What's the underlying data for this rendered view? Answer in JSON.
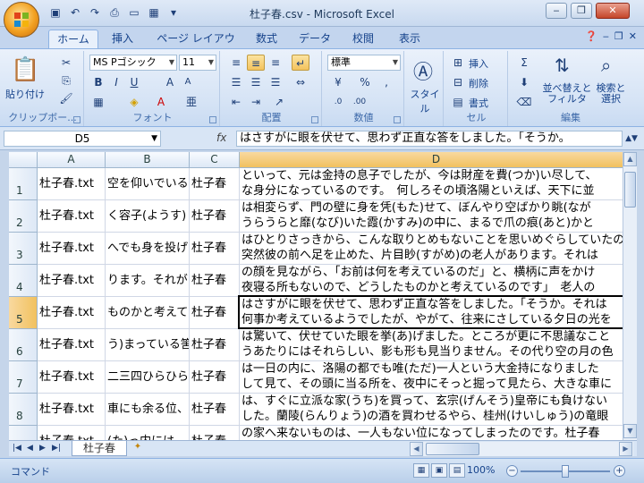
{
  "window": {
    "title": "杜子春.csv - Microsoft Excel",
    "controls": [
      "‒",
      "❐",
      "✕"
    ]
  },
  "tabs": [
    "ホーム",
    "挿入",
    "ページ レイアウト",
    "数式",
    "データ",
    "校閲",
    "表示"
  ],
  "ribbon": {
    "clipboard": {
      "paste_label": "貼り付け",
      "group_label": "クリップボー..."
    },
    "font": {
      "font_name": "MS Pゴシック",
      "font_size": "11",
      "bold": "B",
      "italic": "I",
      "underline": "U",
      "group_label": "フォント"
    },
    "alignment": {
      "group_label": "配置"
    },
    "number": {
      "format": "標準",
      "group_label": "数値"
    },
    "styles": {
      "label": "スタイル"
    },
    "cells": {
      "insert": "挿入",
      "delete": "削除",
      "format": "書式",
      "group_label": "セル"
    },
    "editing": {
      "sort": "並べ替えと\nフィルタ",
      "find": "検索と\n選択",
      "group_label": "編集"
    }
  },
  "formula_bar": {
    "name_box": "D5",
    "fx": "fx",
    "content": "はさすがに眼を伏せて、思わず正直な答をしました。「そうか。"
  },
  "columns": [
    "A",
    "B",
    "C",
    "D"
  ],
  "rows": [
    {
      "num": "1",
      "a": "杜子春.txt",
      "b": "空を仰いでいる",
      "c": "杜子春",
      "d": [
        "といって、元は金持の息子でしたが、今は財産を費(つか)い尽して、",
        "な身分になっているのです。　何しろその頃洛陽といえば、天下に並"
      ]
    },
    {
      "num": "2",
      "a": "杜子春.txt",
      "b": "く容子(ようす)",
      "c": "杜子春",
      "d": [
        "は相変らず、門の壁に身を凭(もた)せて、ぼんやり空ばかり眺(なが",
        "うらうらと靡(なび)いた霞(かすみ)の中に、まるで爪の痕(あと)かと"
      ]
    },
    {
      "num": "3",
      "a": "杜子春.txt",
      "b": "へでも身を投げ",
      "c": "杜子春",
      "d": [
        "はひとりさっきから、こんな取りとめもないことを思いめぐらしていたので",
        "突然彼の前へ足を止めた、片目眇(すがめ)の老人があります。それは"
      ]
    },
    {
      "num": "4",
      "a": "杜子春.txt",
      "b": "ります。それが",
      "c": "杜子春",
      "d": [
        "の顔を見ながら、「お前は何を考えているのだ」と、横柄に声をかけ",
        "夜寝る所もないので、どうしたものかと考えているのです」　老人の"
      ]
    },
    {
      "num": "5",
      "a": "杜子春.txt",
      "b": "ものかと考えて",
      "c": "杜子春",
      "d": [
        "はさすがに眼を伏せて、思わず正直な答をしました。「そうか。それは",
        "何事か考えているようでしたが、やがて、往来にさしている夕日の光を"
      ]
    },
    {
      "num": "6",
      "a": "杜子春.txt",
      "b": "う)まっている筈",
      "c": "杜子春",
      "d": [
        "は驚いて、伏せていた眼を挙(あ)げました。ところが更に不思議なこと",
        "うあたりにはそれらしい、影も形も見当りません。その代り空の月の色"
      ]
    },
    {
      "num": "7",
      "a": "杜子春.txt",
      "b": "二三四ひらひら",
      "c": "杜子春",
      "d": [
        "は一日の内に、洛陽の都でも唯(ただ)一人という大金持になりました",
        "して見て、その頭に当る所を、夜中にそっと掘って見たら、大きな車に"
      ]
    },
    {
      "num": "8",
      "a": "杜子春.txt",
      "b": "車にも余る位、",
      "c": "杜子春",
      "d": [
        "は、すぐに立派な家(うち)を買って、玄宗(げんそう)皇帝にも負けない",
        "した。蘭陵(らんりょう)の酒を買わせるやら、桂州(けいしゅう)の竜眼"
      ]
    },
    {
      "num": "9",
      "a": "杜子春.txt",
      "b": "(た)っ内には",
      "c": "杜子春",
      "d": [
        "の家へ来ないものは、一人もない位になってしまったのです。杜子春",
        ""
      ]
    }
  ],
  "sheet": {
    "tab": "杜子春"
  },
  "status": {
    "mode": "コマンド",
    "zoom": "100%"
  }
}
